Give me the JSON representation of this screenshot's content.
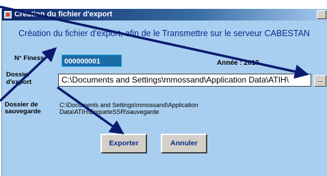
{
  "window": {
    "title": "Création du fichier d'export",
    "heading": "Création du fichier d'export, afin de le Transmettre sur le serveur CABESTAN"
  },
  "form": {
    "finess_label": "N° Finess",
    "finess_value": "000000001",
    "annee_text": "Année : 2010",
    "export_label_line1": "Dossier",
    "export_label_line2": "d'export",
    "export_path": "C:\\Documents and Settings\\mmossand\\Application Data\\ATIH\\",
    "browse_label": "...",
    "sauvegarde_label_line1": "Dossier de",
    "sauvegarde_label_line2": "sauvegarde",
    "sauvegarde_path": "C:\\Documents and Settings\\mmossand\\Application Data\\ATIH\\EnqueteSSR\\sauvegarde"
  },
  "buttons": {
    "exporter": "Exporter",
    "annuler": "Annuler"
  },
  "colors": {
    "window_bg": "#a9cff0",
    "heading": "#0a2a8a",
    "finess_bg": "#1c6ca8",
    "arrow": "#0a1a6e"
  }
}
